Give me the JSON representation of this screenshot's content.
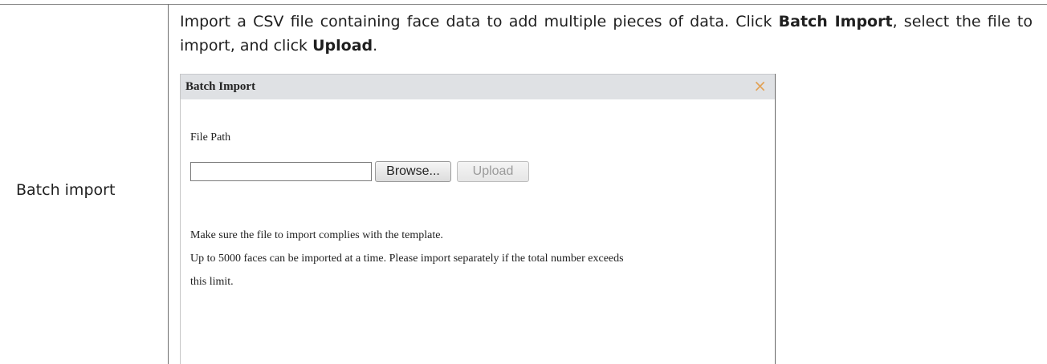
{
  "table": {
    "row_label": "Batch import"
  },
  "description": {
    "part1": "Import a CSV file containing face data to add multiple pieces of data. Click ",
    "bold1": "Batch Import",
    "part2": ", select the file to import, and click ",
    "bold2": "Upload",
    "part3": "."
  },
  "dialog": {
    "title": "Batch Import",
    "close_glyph": "×",
    "file_path_label": "File Path",
    "file_path_value": "",
    "browse_label": "Browse...",
    "upload_label": "Upload",
    "note_1": "Make sure the file to import complies with the template.",
    "note_2": "Up to 5000 faces can be imported at a time. Please import separately if the total number exceeds",
    "note_3": "this limit.",
    "header_color": "#dfe1e4",
    "close_color": "#e2a256"
  }
}
